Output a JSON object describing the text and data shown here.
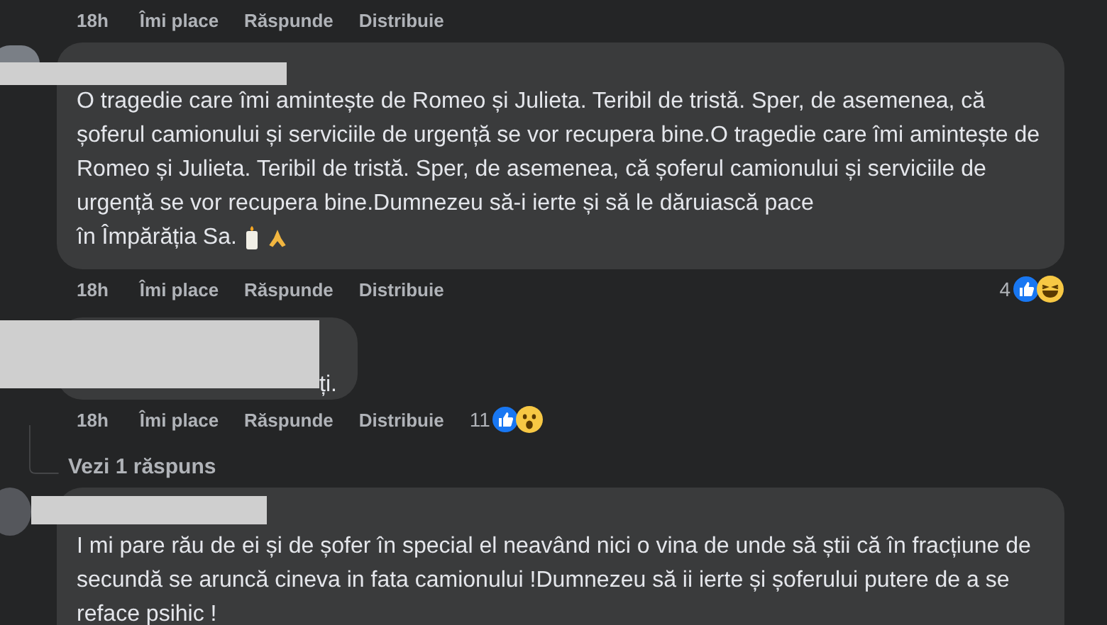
{
  "top_actions": {
    "time": "18h",
    "like": "Îmi place",
    "reply": "Răspunde",
    "share": "Distribuie"
  },
  "comments": [
    {
      "redacted": true,
      "avatar": true,
      "body": "O tragedie care îmi amintește de Romeo și Julieta. Teribil de tristă. Sper, de asemenea, că șoferul camionului și serviciile de urgență se vor recupera bine.O tragedie care îmi amintește de Romeo și Julieta. Teribil de tristă. Sper, de asemenea, că șoferul camionului și serviciile de urgență se vor recupera bine.Dumnezeu să-i ierte și să le dăruiască pace",
      "last_line": "în Împărăția Sa.",
      "emoji": [
        {
          "kind": "candle"
        },
        {
          "kind": "pray"
        }
      ],
      "actions": {
        "time": "18h",
        "like": "Îmi place",
        "reply": "Răspunde",
        "share": "Distribuie"
      },
      "reaction_count": "4",
      "reactions": [
        {
          "kind": "like"
        },
        {
          "kind": "haha"
        }
      ]
    },
    {
      "redacted": true,
      "avatar": false,
      "body": "ți.",
      "actions": {
        "time": "18h",
        "like": "Îmi place",
        "reply": "Răspunde",
        "share": "Distribuie"
      },
      "reaction_count": "11",
      "reactions": [
        {
          "kind": "like"
        },
        {
          "kind": "wow"
        }
      ],
      "replies_link": "Vezi 1 răspuns"
    },
    {
      "redacted": true,
      "avatar": true,
      "body": "I mi pare rău de ei și de șofer în special el neavând nici o vina de unde să știi că în fracțiune de secundă se aruncă cineva in fata camionului !Dumnezeu să ii ierte și șoferului putere de a se reface psihic !"
    }
  ]
}
